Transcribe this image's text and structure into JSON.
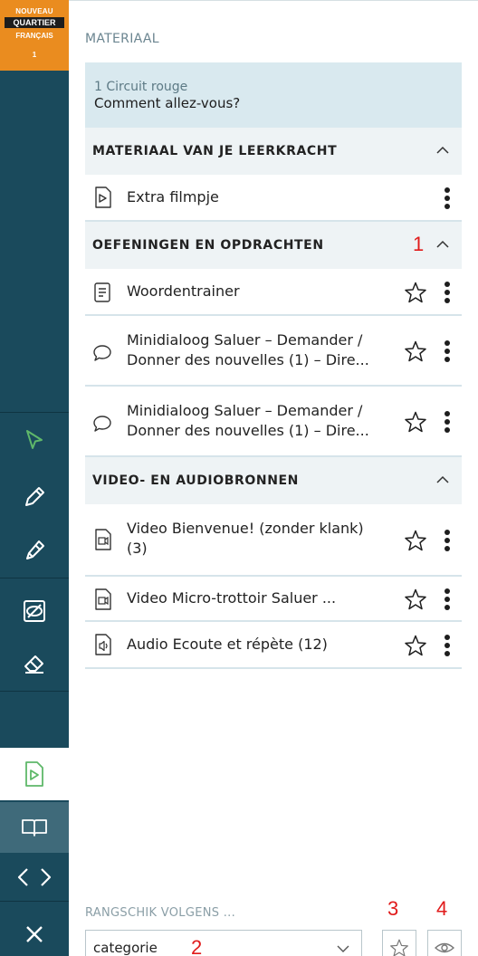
{
  "logo": {
    "line1": "NOUVEAU",
    "line2": "QUARTIER",
    "line3": "FRANÇAIS",
    "line4": "1"
  },
  "toolbar": {
    "tools": [
      "cursor-icon",
      "pencil-icon",
      "highlighter-icon",
      "hide-icon",
      "eraser-icon"
    ],
    "bottom": [
      "exercise-icon",
      "book-icon",
      "code-icon",
      "close-icon"
    ],
    "accent_color": "#5fb86a"
  },
  "panel": {
    "title": "MATERIAAL",
    "lesson_sub": "1 Circuit rouge",
    "lesson_title": "Comment allez-vous?"
  },
  "sections": [
    {
      "label": "MATERIAAL VAN JE LEERKRACHT",
      "items": [
        {
          "text": "Extra filmpje",
          "icon": "video-file-icon"
        }
      ]
    },
    {
      "label": "OEFENINGEN EN OPDRACHTEN",
      "marker": "1",
      "items": [
        {
          "text": "Woordentrainer",
          "icon": "document-icon"
        },
        {
          "line1": "Minidialoog Saluer – Demander /",
          "line2": "Donner des nouvelles (1) – Dire...",
          "icon": "speech-bubble-icon"
        },
        {
          "line1": "Minidialoog Saluer – Demander /",
          "line2": "Donner des nouvelles (1) – Dire...",
          "icon": "speech-bubble-icon"
        }
      ]
    },
    {
      "label": "VIDEO- EN AUDIOBRONNEN",
      "items": [
        {
          "line1": "Video Bienvenue! (zonder klank)",
          "line2": "(3)",
          "icon": "video-file-icon"
        },
        {
          "text": "Video Micro-trottoir Saluer ...",
          "icon": "video-file-icon"
        },
        {
          "text": "Audio Ecoute et répète (12)",
          "icon": "audio-file-icon"
        }
      ]
    }
  ],
  "sort": {
    "label": "RANGSCHIK VOLGENS ...",
    "value": "categorie",
    "marker_select": "2",
    "marker_star": "3",
    "marker_eye": "4"
  },
  "colors": {
    "sidebar": "#1a4a5c",
    "logo": "#ea8c1f",
    "lesson_bg": "#d9e9ef",
    "section_bg": "#eef3f5",
    "marker": "#e11b1b"
  }
}
